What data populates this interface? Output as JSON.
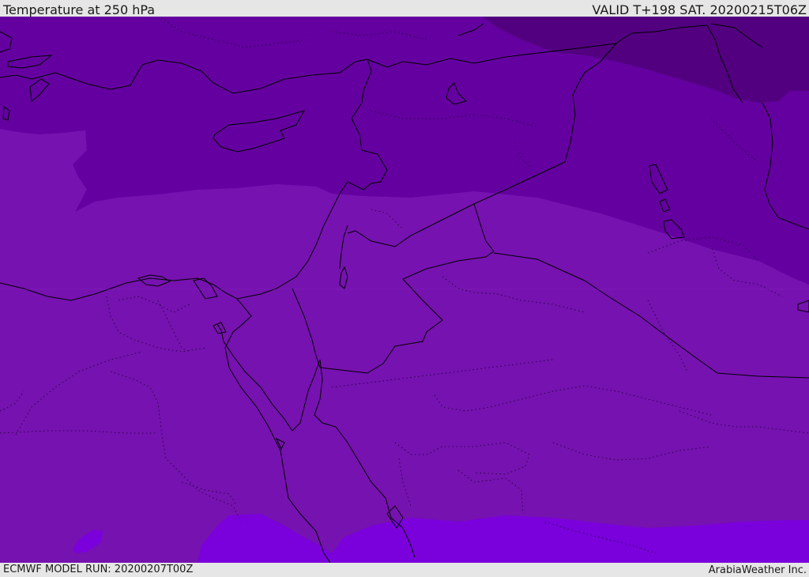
{
  "header": {
    "title": "Temperature at 250 hPa",
    "valid": "VALID T+198 SAT. 20200215T06Z"
  },
  "footer": {
    "model_run": "ECMWF MODEL RUN: 20200207T00Z",
    "credit": "ArabiaWeather Inc."
  },
  "map": {
    "field": "temperature",
    "level": "250 hPa",
    "colors": {
      "band_coldest": "#520080",
      "band_cold": "#6400a0",
      "band_mid": "#7612b0",
      "band_warm": "#7a00dc",
      "coastline": "#000000",
      "border": "#000000"
    }
  }
}
